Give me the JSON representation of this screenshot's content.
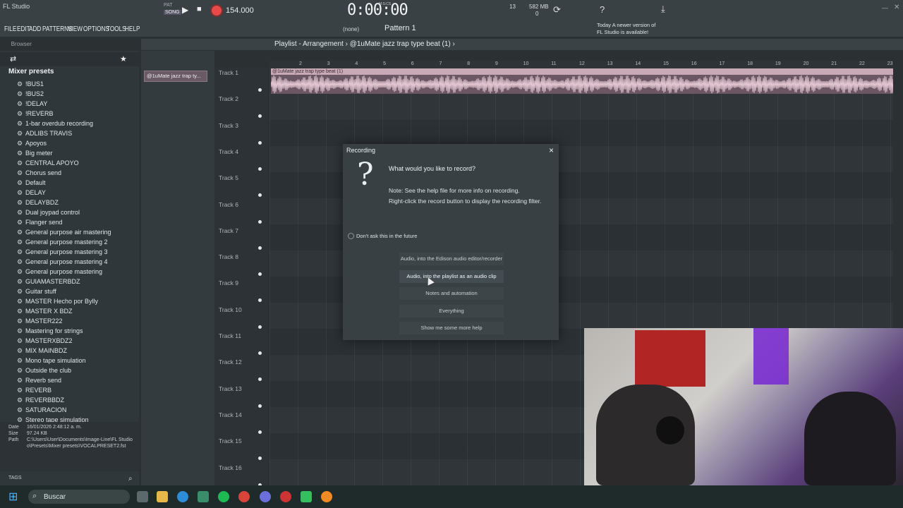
{
  "app": {
    "title": "FL Studio"
  },
  "menu": [
    "FILE",
    "EDIT",
    "ADD",
    "PATTERNS",
    "VIEW",
    "OPTIONS",
    "TOOLS",
    "HELP"
  ],
  "transport": {
    "tempo": "154.000",
    "time": "0:00:00",
    "song_mode": "SONG",
    "pat_mode": "PAT",
    "time_unit": "M:S:CS",
    "memory": "582 MB",
    "cpu_num": "13",
    "poly": "0"
  },
  "toolbar": {
    "pattern": "Pattern 1",
    "snap": "(none)",
    "update_note_line1": "Today",
    "update_note_line2": "A newer version of FL Studio is available!"
  },
  "browser": {
    "header": "Browser",
    "folder": "Mixer presets",
    "items": [
      "!BUS1",
      "!BUS2",
      "!DELAY",
      "!REVERB",
      "1-bar overdub recording",
      "ADLIBS TRAVIS",
      "Apoyos",
      "Big meter",
      "CENTRAL APOYO",
      "Chorus send",
      "Default",
      "DELAY",
      "DELAYBDZ",
      "Dual joypad control",
      "Flanger send",
      "General purpose air mastering",
      "General purpose mastering 2",
      "General purpose mastering 3",
      "General purpose mastering 4",
      "General purpose mastering",
      "GUIAMASTERBDZ",
      "Guitar stuff",
      "MASTER Hecho por Bylly",
      "MASTER X BDZ",
      "MASTER222",
      "Mastering for strings",
      "MASTERXBDZ2",
      "MIX MAINBDZ",
      "Mono tape simulation",
      "Outside the club",
      "Reverb send",
      "REVERB",
      "REVERBBDZ",
      "SATURACION",
      "Stereo tape simulation"
    ],
    "info": {
      "date_k": "Date",
      "date_v": "16/01/2026 2:48:12 a. m.",
      "size_k": "Size",
      "size_v": "97.24 KB",
      "path_k": "Path",
      "path_v1": "C:\\Users\\User\\Documents\\Image-Line\\FL Studio",
      "path_v2": "o\\Presets\\Mixer presets\\VOCALPRESET2.fst"
    },
    "tags": "TAGS"
  },
  "channel": {
    "clip": "@1uMate jazz trap ty..."
  },
  "playlist": {
    "title": "Playlist - Arrangement",
    "clip_path": "@1uMate jazz trap type beat (1)",
    "clip_label": "@1uMate jazz trap type beat (1)",
    "tracks": [
      "Track 1",
      "Track 2",
      "Track 3",
      "Track 4",
      "Track 5",
      "Track 6",
      "Track 7",
      "Track 8",
      "Track 9",
      "Track 10",
      "Track 11",
      "Track 12",
      "Track 13",
      "Track 14",
      "Track 15",
      "Track 16"
    ],
    "ruler": [
      "2",
      "3",
      "4",
      "5",
      "6",
      "7",
      "8",
      "9",
      "10",
      "11",
      "12",
      "13",
      "14",
      "15",
      "16",
      "17",
      "18",
      "19",
      "20",
      "21",
      "22",
      "23"
    ]
  },
  "dialog": {
    "title": "Recording",
    "close": "×",
    "question": "What would you like to record?",
    "note1": "Note: See the help file for more info on recording.",
    "note2": "Right-click the record button to display the recording filter.",
    "checkbox": "Don't ask this in the future",
    "options": [
      "Audio, into the Edison audio editor/recorder",
      "Audio, into the playlist as an audio clip",
      "Notes and automation",
      "Everything",
      "Show me some more help"
    ]
  },
  "taskbar": {
    "search": "Buscar"
  }
}
